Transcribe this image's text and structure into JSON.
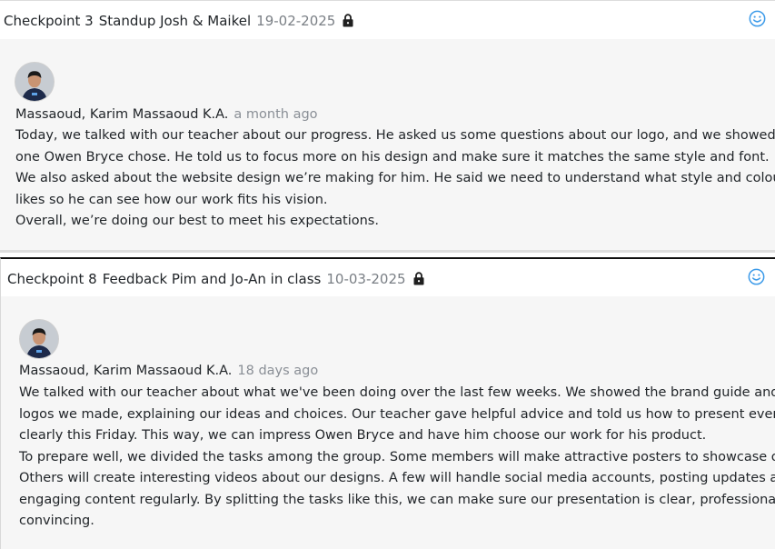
{
  "entries": [
    {
      "checkpoint": "Checkpoint 3",
      "title": "Standup Josh & Maikel",
      "date": "19-02-2025",
      "author": "Massaoud, Karim Massaoud K.A.",
      "time_ago": "a month ago",
      "lines": [
        "Today, we talked with our teacher about our progress. He asked us some questions about our logo, and we showed him the",
        "one Owen Bryce chose. He told us to focus more on his design and make sure it matches the same style and font.",
        "We also asked about the website design we’re making for him. He said we need to understand what style and colours he",
        "likes so he can see how our work fits his vision.",
        "Overall, we’re doing our best to meet his expectations."
      ]
    },
    {
      "checkpoint": "Checkpoint 8",
      "title": "Feedback Pim and Jo-An in class",
      "date": "10-03-2025",
      "author": "Massaoud, Karim Massaoud K.A.",
      "time_ago": "18 days ago",
      "lines": [
        "We talked with our teacher about what we've been doing over the last few weeks. We showed the brand guide and the",
        "logos we made, explaining our ideas and choices. Our teacher gave helpful advice and told us how to present everything",
        "clearly this Friday. This way, we can impress Owen Bryce and have him choose our work for his product.",
        "To prepare well, we divided the tasks among the group. Some members will make attractive posters to showcase our brand.",
        "Others will create interesting videos about our designs. A few will handle social media accounts, posting updates and",
        "engaging content regularly. By splitting the tasks like this, we can make sure our presentation is clear, professional, and",
        "convincing."
      ]
    }
  ],
  "colors": {
    "accent_icon": "#3d9be9",
    "muted_text": "#7a7f85",
    "card_bg": "#f6f6f6"
  },
  "icons": [
    "lock-icon",
    "smile-icon",
    "avatar"
  ]
}
